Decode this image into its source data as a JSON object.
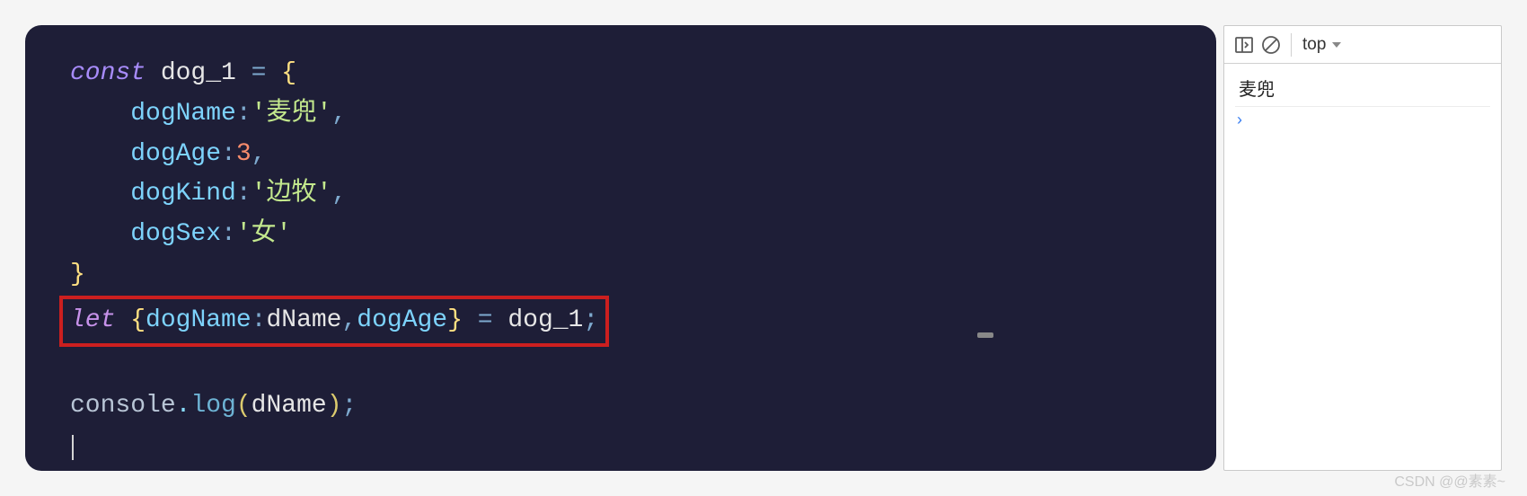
{
  "editor": {
    "lines": {
      "l1_kw": "const",
      "l1_var": " dog_1 ",
      "l1_eq": "= ",
      "l1_brace": "{",
      "l2_indent": "    ",
      "l2_prop": "dogName",
      "l2_colon": ":",
      "l2_str": "'麦兜'",
      "l2_comma": ",",
      "l3_prop": "dogAge",
      "l3_colon": ":",
      "l3_num": "3",
      "l3_comma": ",",
      "l4_prop": "dogKind",
      "l4_colon": ":",
      "l4_str": "'边牧'",
      "l4_comma": ",",
      "l5_prop": "dogSex",
      "l5_colon": ":",
      "l5_str": "'女'",
      "l6_brace": "}",
      "l7_kw": "let",
      "l7_open": " {",
      "l7_p1": "dogName",
      "l7_c1": ":",
      "l7_alias": "dName",
      "l7_comma": ",",
      "l7_p2": "dogAge",
      "l7_close": "} ",
      "l7_eq": "= ",
      "l7_var": "dog_1",
      "l7_semi": ";",
      "l9_obj": "console",
      "l9_dot": ".",
      "l9_func": "log",
      "l9_open": "(",
      "l9_arg": "dName",
      "l9_close": ")",
      "l9_semi": ";"
    }
  },
  "devtools": {
    "context": "top",
    "output": "麦兜",
    "prompt": "›"
  },
  "watermark": "CSDN @@素素~"
}
